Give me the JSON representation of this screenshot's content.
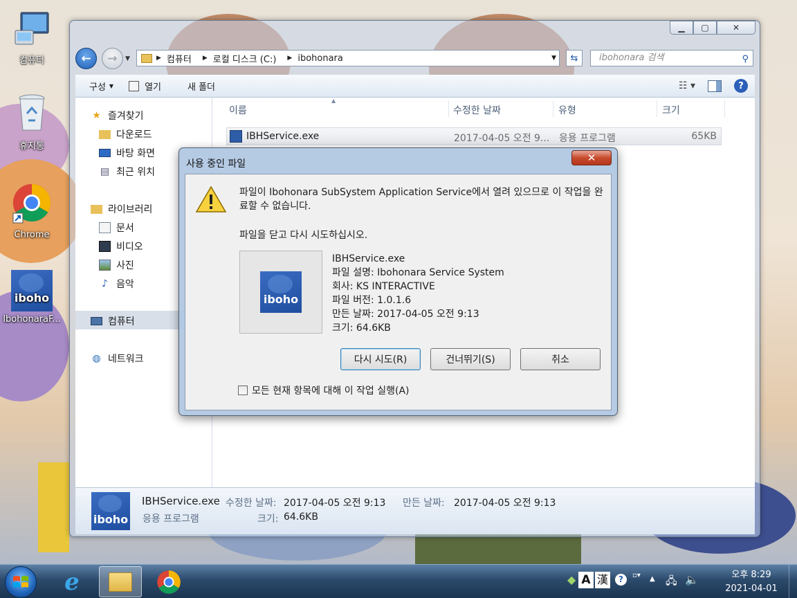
{
  "desktop": {
    "icons": [
      {
        "label": "컴퓨터"
      },
      {
        "label": "휴지통"
      },
      {
        "label": "Chrome"
      },
      {
        "label": "IbohonaraF..."
      }
    ]
  },
  "explorer": {
    "window_controls": {
      "minimize": "▁",
      "maximize": "▢",
      "close": "✕"
    },
    "nav": {
      "back": "←",
      "forward": "→"
    },
    "breadcrumb": [
      "컴퓨터",
      "로컬 디스크 (C:)",
      "ibohonara"
    ],
    "search_placeholder": "ibohonara 검색",
    "toolbar": {
      "organize": "구성",
      "open": "열기",
      "new_folder": "새 폴더"
    },
    "nav_pane": {
      "favorites": "즐겨찾기",
      "downloads": "다운로드",
      "desktop": "바탕 화면",
      "recent": "최근 위치",
      "libraries": "라이브러리",
      "documents": "문서",
      "videos": "비디오",
      "pictures": "사진",
      "music": "음악",
      "computer": "컴퓨터",
      "network": "네트워크"
    },
    "columns": {
      "name": "이름",
      "modified": "수정한 날짜",
      "type": "유형",
      "size": "크기"
    },
    "files": [
      {
        "name": "IBHService.exe",
        "modified": "2017-04-05 오전 9...",
        "type": "응용 프로그램",
        "size": "65KB"
      }
    ],
    "details": {
      "filename": "IBHService.exe",
      "modified_label": "수정한 날짜:",
      "modified_value": "2017-04-05 오전 9:13",
      "created_label": "만든 날짜:",
      "created_value": "2017-04-05 오전 9:13",
      "type": "응용 프로그램",
      "size_label": "크기:",
      "size_value": "64.6KB"
    }
  },
  "dialog": {
    "title": "사용 중인 파일",
    "close": "✕",
    "message": "파일이 Ibohonara SubSystem Application Service에서 열려 있으므로 이 작업을 완료할 수 없습니다.",
    "message2": "파일을 닫고 다시 시도하십시오.",
    "file_info": {
      "name": "IBHService.exe",
      "description": "파일 설명: Ibohonara Service System",
      "company": "회사: KS INTERACTIVE",
      "version": "파일 버전: 1.0.1.6",
      "created": "만든 날짜: 2017-04-05 오전 9:13",
      "size": "크기: 64.6KB"
    },
    "buttons": {
      "retry": "다시 시도(R)",
      "skip": "건너뛰기(S)",
      "cancel": "취소"
    },
    "checkbox_label": "모든 현재 항목에 대해 이 작업 실행(A)"
  },
  "logo_text": "iboho",
  "taskbar": {
    "ime_a": "A",
    "ime_han": "漢",
    "clock_time": "오후 8:29",
    "clock_date": "2021-04-01"
  }
}
